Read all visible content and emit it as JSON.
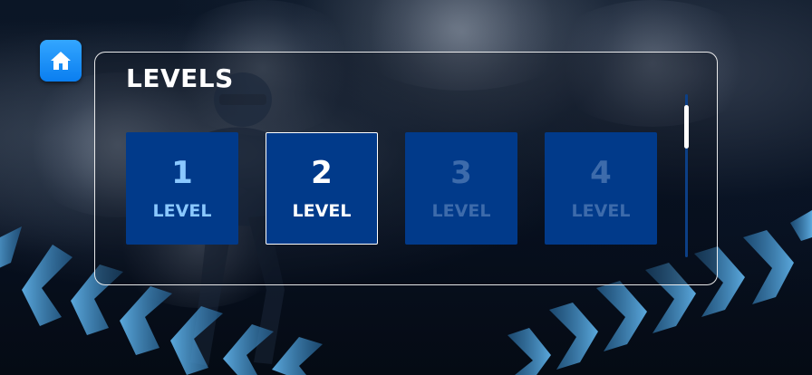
{
  "screen": {
    "title": "LEVELS",
    "home_icon": "home-icon"
  },
  "levels": [
    {
      "number": "1",
      "label": "LEVEL",
      "state": "unlocked"
    },
    {
      "number": "2",
      "label": "LEVEL",
      "state": "selected"
    },
    {
      "number": "3",
      "label": "LEVEL",
      "state": "locked"
    },
    {
      "number": "4",
      "label": "LEVEL",
      "state": "locked"
    }
  ],
  "colors": {
    "home_button": "#1a8cff",
    "tile_bg": "#013a8a",
    "unlocked_text": "#8ac8ff",
    "locked_text": "#3d6bab",
    "chevron": "#4a9fd6"
  }
}
